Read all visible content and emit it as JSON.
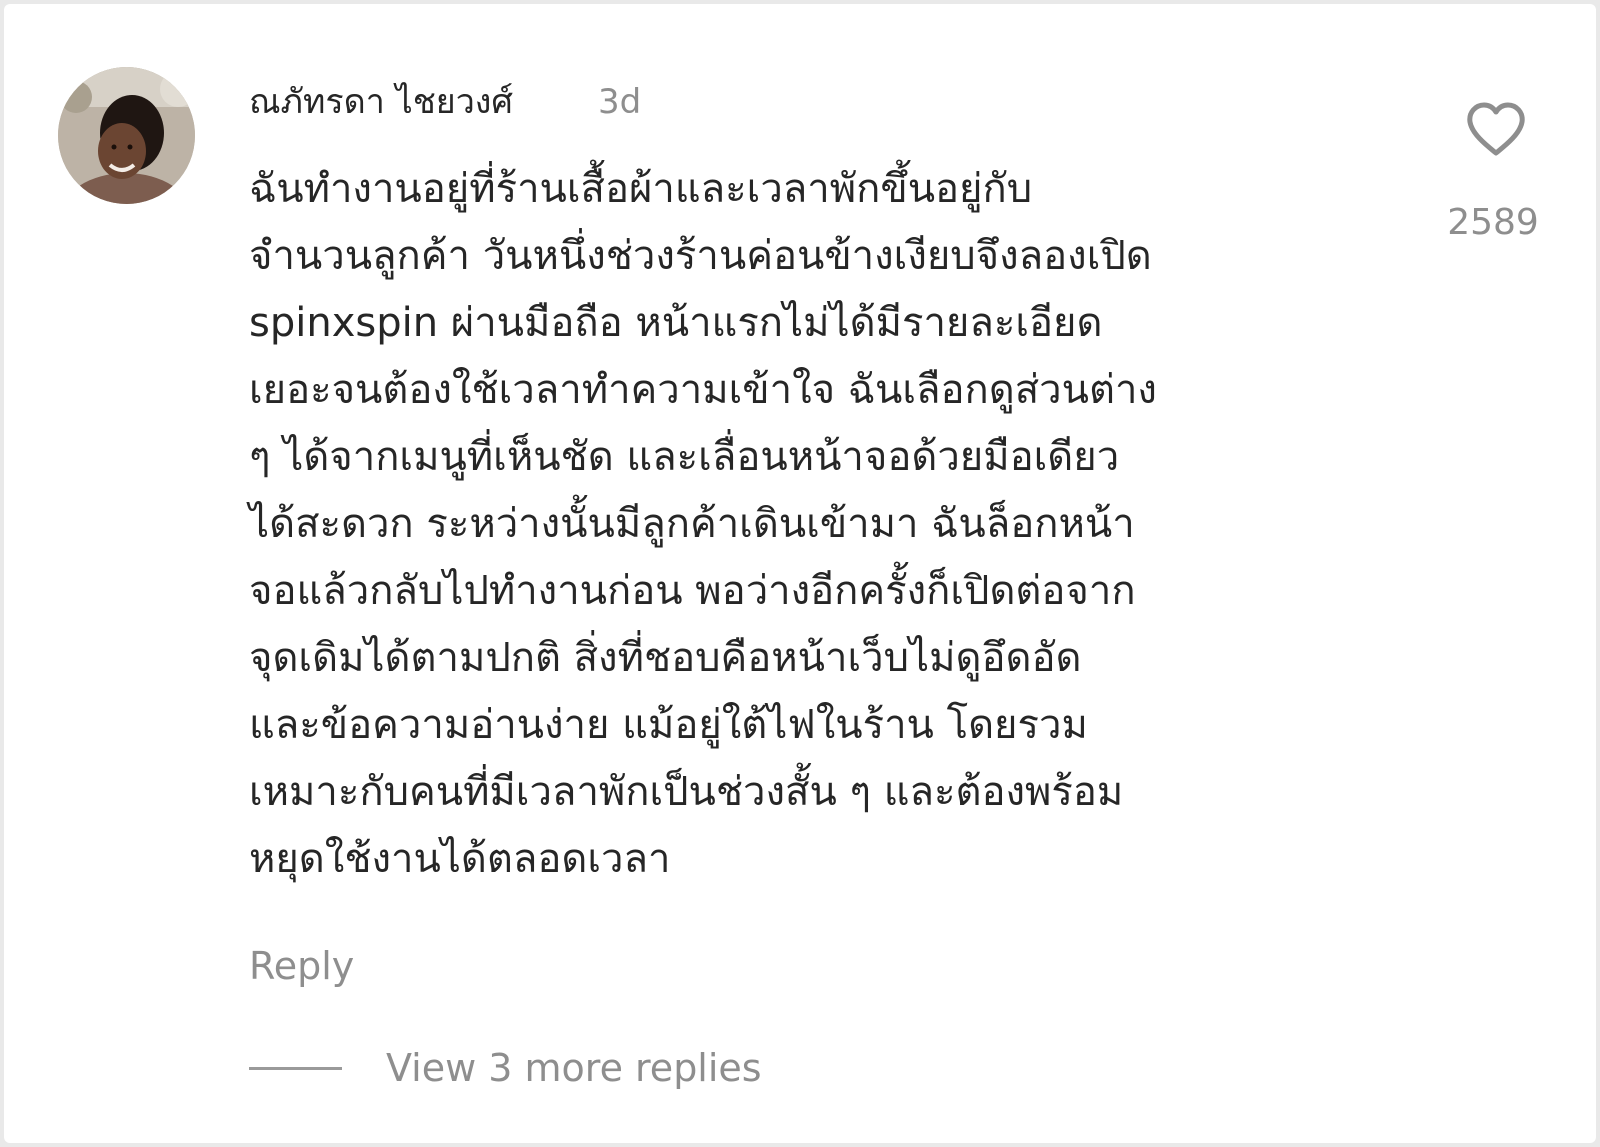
{
  "comment": {
    "author": "ณภัทรดา ไชยวงศ์",
    "timestamp": "3d",
    "body_lines": [
      "ฉันทำงานอยู่ที่ร้านเสื้อผ้าและเวลาพักขึ้นอยู่กับ",
      "จำนวนลูกค้า วันหนึ่งช่วงร้านค่อนข้างเงียบจึงลองเปิด",
      "spinxspin ผ่านมือถือ หน้าแรกไม่ได้มีรายละเอียด",
      "เยอะจนต้องใช้เวลาทำความเข้าใจ ฉันเลือกดูส่วนต่าง",
      "ๆ ได้จากเมนูที่เห็นชัด และเลื่อนหน้าจอด้วยมือเดียว",
      "ได้สะดวก ระหว่างนั้นมีลูกค้าเดินเข้ามา ฉันล็อกหน้า",
      "จอแล้วกลับไปทำงานก่อน พอว่างอีกครั้งก็เปิดต่อจาก",
      "จุดเดิมได้ตามปกติ สิ่งที่ชอบคือหน้าเว็บไม่ดูอึดอัด",
      "และข้อความอ่านง่าย แม้อยู่ใต้ไฟในร้าน โดยรวม",
      "เหมาะกับคนที่มีเวลาพักเป็นช่วงสั้น ๆ และต้องพร้อม",
      "หยุดใช้งานได้ตลอดเวลา"
    ],
    "like_count": "2589",
    "like_icon": "heart-outline-icon",
    "reply_label": "Reply",
    "view_replies_label": "View 3 more replies"
  },
  "colors": {
    "text_primary": "#262626",
    "text_secondary": "#8e8e8e",
    "background": "#ffffff"
  }
}
